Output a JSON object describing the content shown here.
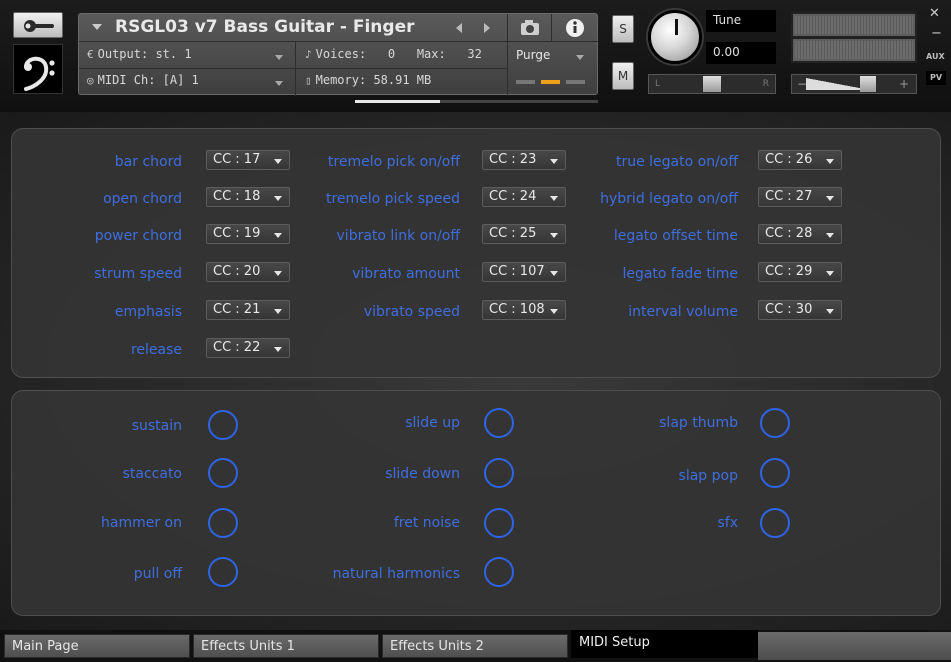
{
  "header": {
    "title": "RSGL03 v7 Bass Guitar - Finger",
    "output_label": "Output:",
    "output_value": "st. 1",
    "voices_label": "Voices:",
    "voices_value": "0",
    "max_label": "Max:",
    "max_value": "32",
    "midi_label": "MIDI Ch:",
    "midi_value": "[A]  1",
    "memory_label": "Memory:",
    "memory_value": "58.91 MB",
    "purge_label": "Purge",
    "solo_label": "S",
    "mute_label": "M",
    "tune_label": "Tune",
    "tune_value": "0.00",
    "pan_left": "L",
    "pan_right": "R",
    "vol_minus": "−",
    "vol_plus": "+",
    "aux_label": "AUX",
    "pv_label": "PV",
    "icons": {
      "wrench": "wrench-icon",
      "logo": "bass-clef-icon",
      "camera": "camera-icon",
      "info": "info-icon",
      "close": "close-icon",
      "minimize": "minimize-icon"
    },
    "purge_meter_colors": [
      "#7a7a7a",
      "#f0a018",
      "#7a7a7a"
    ]
  },
  "cc_assignments": {
    "column1": [
      {
        "label": "bar chord",
        "value": "CC : 17"
      },
      {
        "label": "open chord",
        "value": "CC : 18"
      },
      {
        "label": "power chord",
        "value": "CC : 19"
      },
      {
        "label": "strum speed",
        "value": "CC : 20"
      },
      {
        "label": "emphasis",
        "value": "CC : 21"
      },
      {
        "label": "release",
        "value": "CC : 22"
      }
    ],
    "column2": [
      {
        "label": "tremelo pick on/off",
        "value": "CC : 23"
      },
      {
        "label": "tremelo pick speed",
        "value": "CC : 24"
      },
      {
        "label": "vibrato link on/off",
        "value": "CC : 25"
      },
      {
        "label": "vibrato amount",
        "value": "CC : 107"
      },
      {
        "label": "vibrato speed",
        "value": "CC : 108"
      }
    ],
    "column3": [
      {
        "label": "true legato on/off",
        "value": "CC : 26"
      },
      {
        "label": "hybrid legato on/off",
        "value": "CC : 27"
      },
      {
        "label": "legato offset time",
        "value": "CC : 28"
      },
      {
        "label": "legato fade time",
        "value": "CC : 29"
      },
      {
        "label": "interval volume",
        "value": "CC : 30"
      }
    ]
  },
  "keyswitches": {
    "column1": [
      {
        "label": "sustain"
      },
      {
        "label": "staccato"
      },
      {
        "label": "hammer on"
      },
      {
        "label": "pull off"
      }
    ],
    "column2": [
      {
        "label": "slide up"
      },
      {
        "label": "slide down"
      },
      {
        "label": "fret noise"
      },
      {
        "label": "natural harmonics"
      }
    ],
    "column3": [
      {
        "label": "slap thumb"
      },
      {
        "label": "slap pop"
      },
      {
        "label": "sfx"
      }
    ]
  },
  "colors": {
    "label_blue": "#3f6ee0",
    "ring_blue": "#2e64e6"
  },
  "tabs": [
    {
      "label": "Main Page",
      "active": false
    },
    {
      "label": "Effects Units 1",
      "active": false
    },
    {
      "label": "Effects Units 2",
      "active": false
    },
    {
      "label": "MIDI Setup",
      "active": true
    }
  ]
}
